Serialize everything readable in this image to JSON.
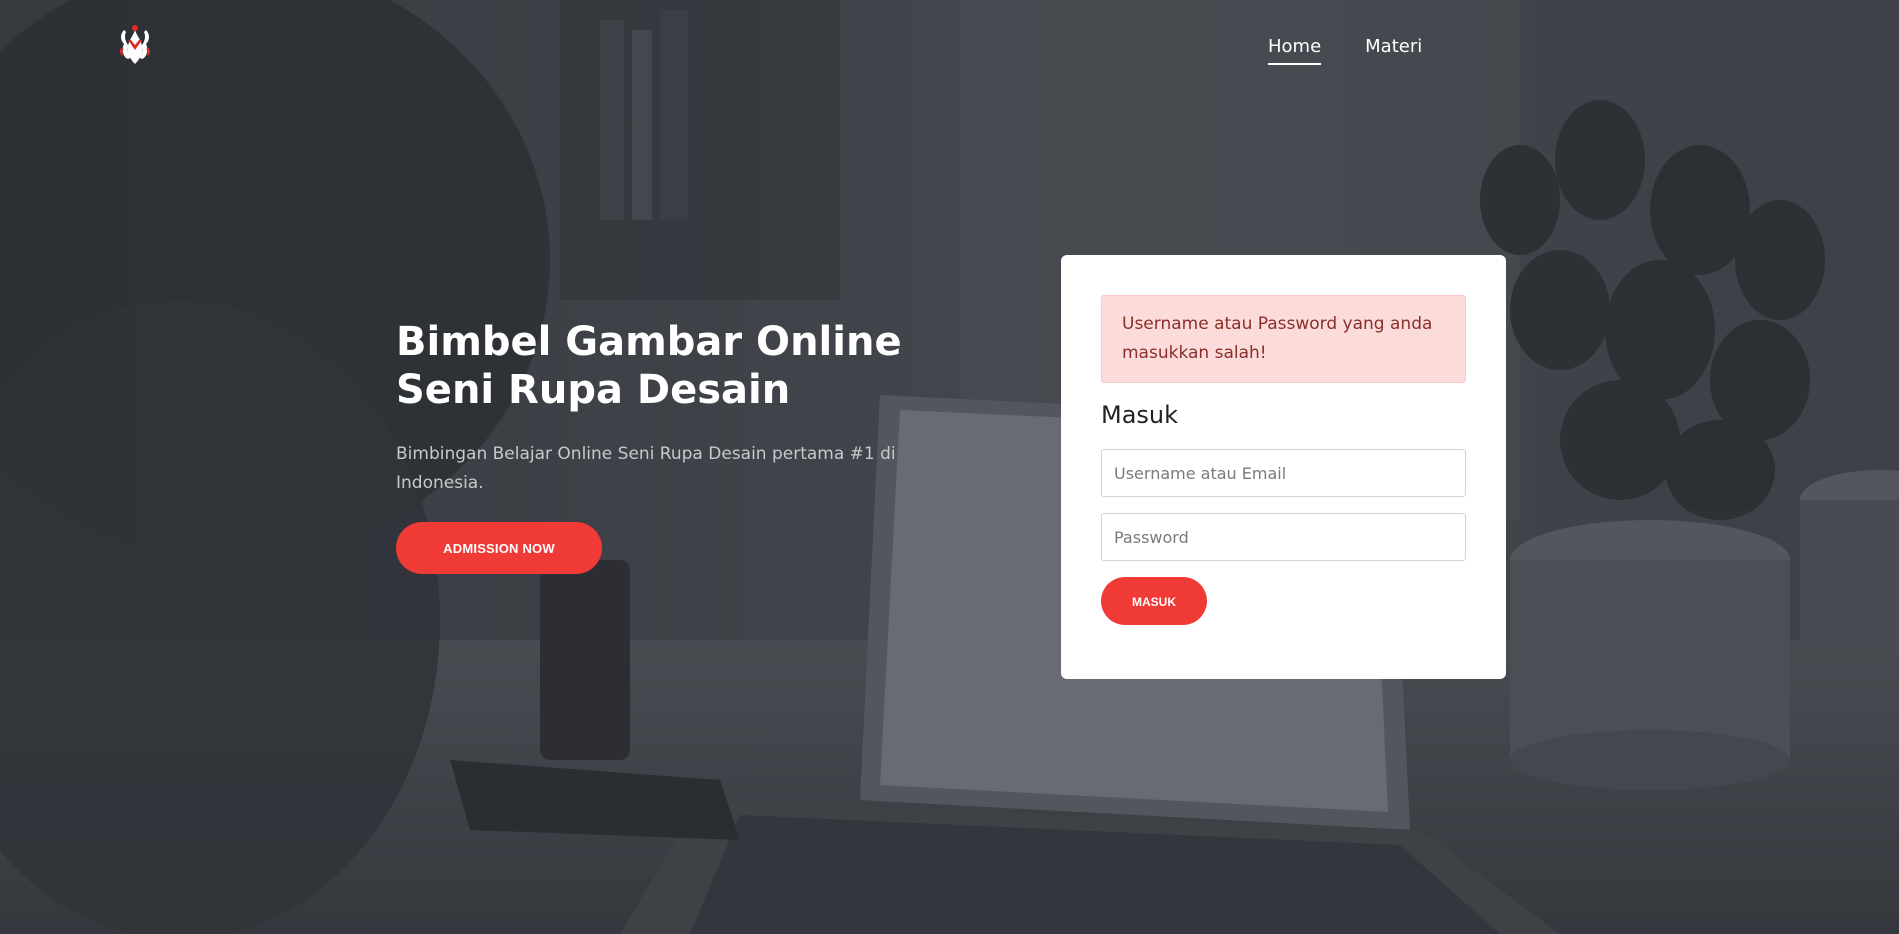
{
  "header": {
    "logo_icon": "crown-crest-logo-icon",
    "nav": [
      {
        "label": "Home",
        "active": true
      },
      {
        "label": "Materi",
        "active": false
      }
    ]
  },
  "hero": {
    "title": "Bimbel Gambar Online Seni Rupa Desain",
    "subtitle": "Bimbingan Belajar Online Seni Rupa Desain pertama #1 di Indonesia.",
    "cta_label": "ADMISSION NOW"
  },
  "login": {
    "alert_text": "Username atau Password yang anda masukkan salah!",
    "title": "Masuk",
    "username_placeholder": "Username atau Email",
    "password_placeholder": "Password",
    "submit_label": "MASUK"
  },
  "colors": {
    "accent": "#ef3a35",
    "alert_bg": "#fcdcda",
    "alert_text": "#8a2f2a",
    "overlay": "#45484d"
  }
}
